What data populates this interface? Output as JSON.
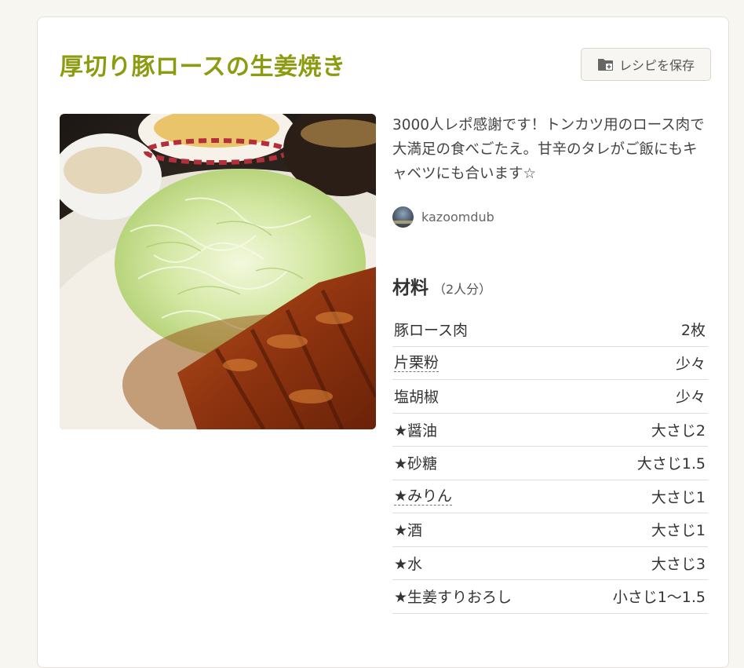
{
  "recipe": {
    "title": "厚切り豚ロースの生姜焼き",
    "save_label": "レシピを保存",
    "description": "3000人レポ感謝です！トンカツ用のロース肉で大満足の食べごたえ。甘辛のタレがご飯にもキャベツにも合います☆",
    "author": "kazoomdub"
  },
  "ingredients": {
    "heading": "材料",
    "serving": "（2人分）",
    "items": [
      {
        "name": "豚ロース肉",
        "amount": "2枚"
      },
      {
        "name": "片栗粉",
        "amount": "少々"
      },
      {
        "name": "塩胡椒",
        "amount": "少々"
      },
      {
        "name": "★醤油",
        "amount": "大さじ2"
      },
      {
        "name": "★砂糖",
        "amount": "大さじ1.5"
      },
      {
        "name": "★みりん",
        "amount": "大さじ1"
      },
      {
        "name": "★酒",
        "amount": "大さじ1"
      },
      {
        "name": "★水",
        "amount": "大さじ3"
      },
      {
        "name": "★生姜すりおろし",
        "amount": "小さじ1〜1.5"
      }
    ]
  },
  "colors": {
    "title": "#8c9b10",
    "page_bg": "#f8f6f0"
  },
  "icons": {
    "save": "folder-plus-icon"
  }
}
